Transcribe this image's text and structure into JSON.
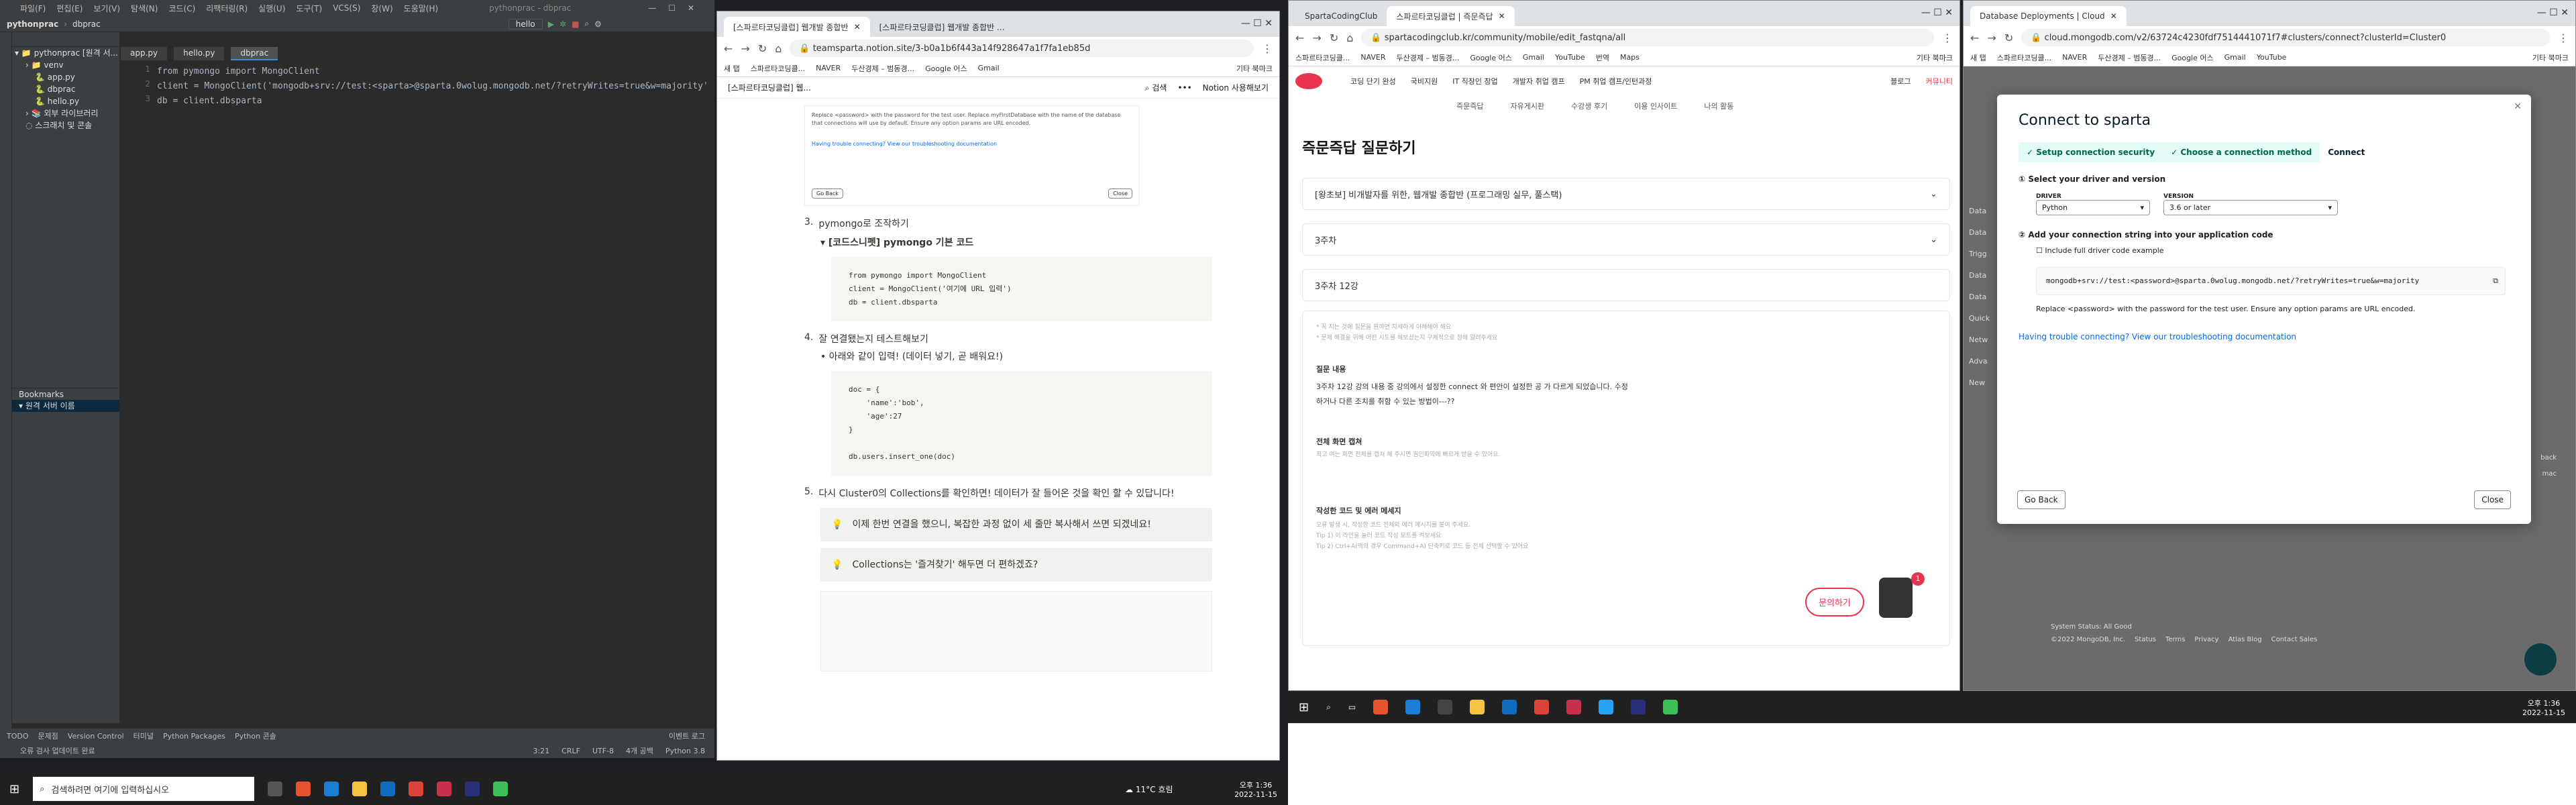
{
  "ide": {
    "project": "pythonprac",
    "file_path": "dbprac",
    "title": "pythonprac - dbprac",
    "menu": [
      "파일(F)",
      "편집(E)",
      "보기(V)",
      "탐색(N)",
      "코드(C)",
      "리팩터링(R)",
      "실행(U)",
      "도구(T)",
      "VCS(S)",
      "창(W)",
      "도움말(H)"
    ],
    "run_config": "hello",
    "tabs": [
      "app.py",
      "hello.py",
      "dbprac"
    ],
    "tree": [
      "pythonprac [원격 서...",
      "venv",
      "app.py",
      "dbprac",
      "hello.py",
      "외부 라이브러리",
      "스크래치 및 콘솔"
    ],
    "bookmarks_label": "Bookmarks",
    "bookmark_item": "원격 서버 이름",
    "code": [
      "from pymongo import MongoClient",
      "client = MongoClient('mongodb+srv://test:<sparta>@sparta.0wolug.mongodb.net/?retryWrites=true&w=majority')",
      "db = client.dbsparta"
    ],
    "line_numbers": [
      "1",
      "2",
      "3"
    ],
    "bottom_tabs": [
      "TODO",
      "문제점",
      "Version Control",
      "터미널",
      "Python Packages",
      "Python 콘솔"
    ],
    "event_log": "이벤트 로그",
    "status": [
      "3:21",
      "CRLF",
      "UTF-8",
      "4개 공백",
      "Python 3.8"
    ],
    "status_left": "오류 검사 업데이트 완료"
  },
  "notion": {
    "tabs": [
      "[스파르타코딩클럽] 웹개발 종합반",
      "[스파르타코딩클럽] 웹개발 종합반 ..."
    ],
    "url": "teamsparta.notion.site/3-b0a1b6f443a14f928647a1f7fa1eb85d",
    "bookmarks": [
      "새 탭",
      "스파르타코딩클...",
      "NAVER",
      "두산경제 – 범동경...",
      "Google 어스",
      "Gmail",
      "기타 북마크"
    ],
    "page_title": "[스파르타코딩클럽] 웹...",
    "search": "검색",
    "notion_button": "Notion 사용해보기",
    "screenshot_text": "Replace <password> with the password for the test user. Replace myFirstDatabase with the name of the database that connections will use by default. Ensure any option params are URL encoded.",
    "trouble": "Having trouble connecting? View our troubleshooting documentation",
    "goback": "Go Back",
    "close": "Close",
    "step3": "pymongo로 조작하기",
    "toggle3": "[코드스니펫] pymongo 기본 코드",
    "code3": [
      "from pymongo import MongoClient",
      "client = MongoClient('여기에 URL 입력')",
      "db = client.dbsparta"
    ],
    "step4": "잘 연결됐는지 테스트해보기",
    "bullet4": "아래와 같이 입력! (데이터 넣기, 곧 배워요!)",
    "code4": [
      "doc = {",
      "    'name':'bob',",
      "    'age':27",
      "}",
      "",
      "db.users.insert_one(doc)"
    ],
    "step5": "다시 Cluster0의 Collections를 확인하면! 데이터가 잘 들어온 것을 확인 할 수 있답니다!",
    "callout1": "이제 한번 연결을 했으니, 복잡한 과정 없이 세 줄만 복사해서 쓰면 되겠네요!",
    "callout2": "Collections는 '즐겨찾기' 해두면 더 편하겠죠?",
    "nums": [
      "3.",
      "4.",
      "5."
    ]
  },
  "sparta": {
    "tabs": [
      "SpartaCodingClub",
      "스파르타코딩클럽 | 즉문즉답"
    ],
    "url": "spartacodingclub.kr/community/mobile/edit_fastqna/all",
    "bookmarks": [
      "스파르타코딩클...",
      "NAVER",
      "두산경제 – 범동경...",
      "Google 어스",
      "Gmail",
      "YouTube",
      "번역",
      "Maps",
      "기타 북마크"
    ],
    "nav": [
      "코딩 단기 완성",
      "국비지원",
      "IT 직장인 창업",
      "개발자 취업 캠프",
      "PM 취업 캠프/인턴과정",
      "블로그",
      "커뮤니티"
    ],
    "subnav": [
      "즉문즉답",
      "자유게시판",
      "수강생 후기",
      "이용 인사이트",
      "나의 활동"
    ],
    "heading": "즉문즉답 질문하기",
    "select1": "[왕초보] 비개발자를 위한, 웹개발 종합반 (프로그래밍 실무, 풀스택)",
    "select2": "3주차",
    "input_title": "3주차 12강",
    "hint1": "* 꼭 지는 것에 질문을 원하면 자세하게 이해해야 해요",
    "hint2": "* 문제 해결을 위해 어떤 시도를 해보셨는지 구체적으로 정해 알려주세요",
    "q_label": "질문 내용",
    "q_text": "3주차 12강 강의 내용 중 강의에서 설정한 connect 와 편안이 설정한 공 가 다르게 되었습니다. 수정 하거나 다른 조치를 취함 수 있는 방법이---??",
    "screen_label": "전체 화면 캡쳐",
    "screen_hint": "최고 여는 화면 전체를 캡쳐 해 주시면 원인파악에 빠르게 받을 수 있어요.",
    "code_label": "작성한 코드 및 에러 메세지",
    "code_hint1": "오류 발생 시, 작성한 코드 전체와 에러 메시지를 붙여 주세요.",
    "code_hint2": "Tip 1) 이 라인을 눌러 코드 작성 모드를 켜보세요",
    "code_hint3": "Tip 2) Ctrl+A(맥의 경우 Command+A) 단축키로 코드 등 전체 선택할 수 있어요",
    "ask_button": "문의하기",
    "badge": "1"
  },
  "mongo": {
    "tabs": [
      "Database Deployments | Cloud"
    ],
    "url": "cloud.mongodb.com/v2/63724c4230fdf7514441071f7#clusters/connect?clusterId=Cluster0",
    "bookmarks": [
      "새 탭",
      "스파르타코딩클...",
      "NAVER",
      "두산경제 – 범동경...",
      "Google 어스",
      "Gmail",
      "YouTube",
      "기타 북마크"
    ],
    "modal_title": "Connect to sparta",
    "steps": [
      "Setup connection security",
      "Choose a connection method",
      "Connect"
    ],
    "step1_label": "Select your driver and version",
    "driver_label": "DRIVER",
    "driver_value": "Python",
    "version_label": "VERSION",
    "version_value": "3.6 or later",
    "step2_label": "Add your connection string into your application code",
    "include_label": "Include full driver code example",
    "conn_string": "mongodb+srv://test:<password>@sparta.0wolug.mongodb.net/?retryWrites=true&w=majority",
    "replace_text": "Replace <password> with the password for the test user. Ensure any option params are URL encoded.",
    "trouble": "Having trouble connecting? View our troubleshooting documentation",
    "go_back": "Go Back",
    "close": "Close",
    "side": [
      "Data",
      "Data",
      "Trigg",
      "Data",
      "Data",
      "Quick",
      "Netw",
      "Adva",
      "New"
    ],
    "footer_status": "System Status: All Good",
    "footer_copy": "©2022 MongoDB, Inc.",
    "footer_links": [
      "Status",
      "Terms",
      "Privacy",
      "Atlas Blog",
      "Contact Sales"
    ],
    "back": "back",
    "mac": "mac"
  },
  "taskbar_left": {
    "search": "검색하려면 여기에 입력하십시오",
    "weather": "11°C 흐림",
    "time": "오후 1:36",
    "date": "2022-11-15"
  },
  "taskbar_right": {
    "time": "오후 1:36",
    "date": "2022-11-15"
  },
  "clock_mongo": {
    "time": "오후 1:36",
    "date": "2022-11-15"
  },
  "colors": {
    "accent": "#4a88c7",
    "sparta_red": "#e8344e",
    "mongo_green": "#13aa52",
    "link": "#016bf8"
  }
}
